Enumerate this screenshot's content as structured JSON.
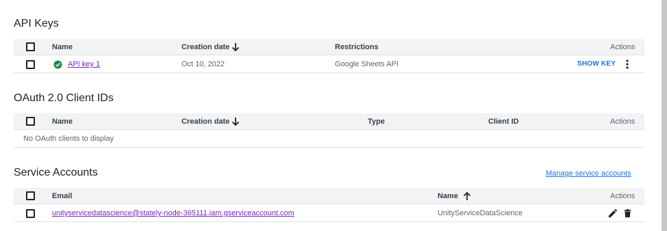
{
  "api_keys": {
    "title": "API Keys",
    "columns": {
      "name": "Name",
      "creation_date": "Creation date",
      "restrictions": "Restrictions",
      "actions": "Actions"
    },
    "rows": [
      {
        "name": "API key 1",
        "creation_date": "Oct 10, 2022",
        "restrictions": "Google Sheets API",
        "action": "SHOW KEY"
      }
    ]
  },
  "oauth": {
    "title": "OAuth 2.0 Client IDs",
    "columns": {
      "name": "Name",
      "creation_date": "Creation date",
      "type": "Type",
      "client_id": "Client ID",
      "actions": "Actions"
    },
    "empty_message": "No OAuth clients to display"
  },
  "service_accounts": {
    "title": "Service Accounts",
    "manage_link": "Manage service accounts",
    "columns": {
      "email": "Email",
      "name": "Name",
      "actions": "Actions"
    },
    "rows": [
      {
        "email": "unityservicedatascience@stately-node-365111.iam.gserviceaccount.com",
        "name": "UnityServiceDataScience"
      }
    ]
  },
  "colors": {
    "link_purple": "#7627bb",
    "link_blue": "#1a73e8",
    "success_green": "#1e8e3e",
    "header_bg": "#f1f3f4"
  }
}
